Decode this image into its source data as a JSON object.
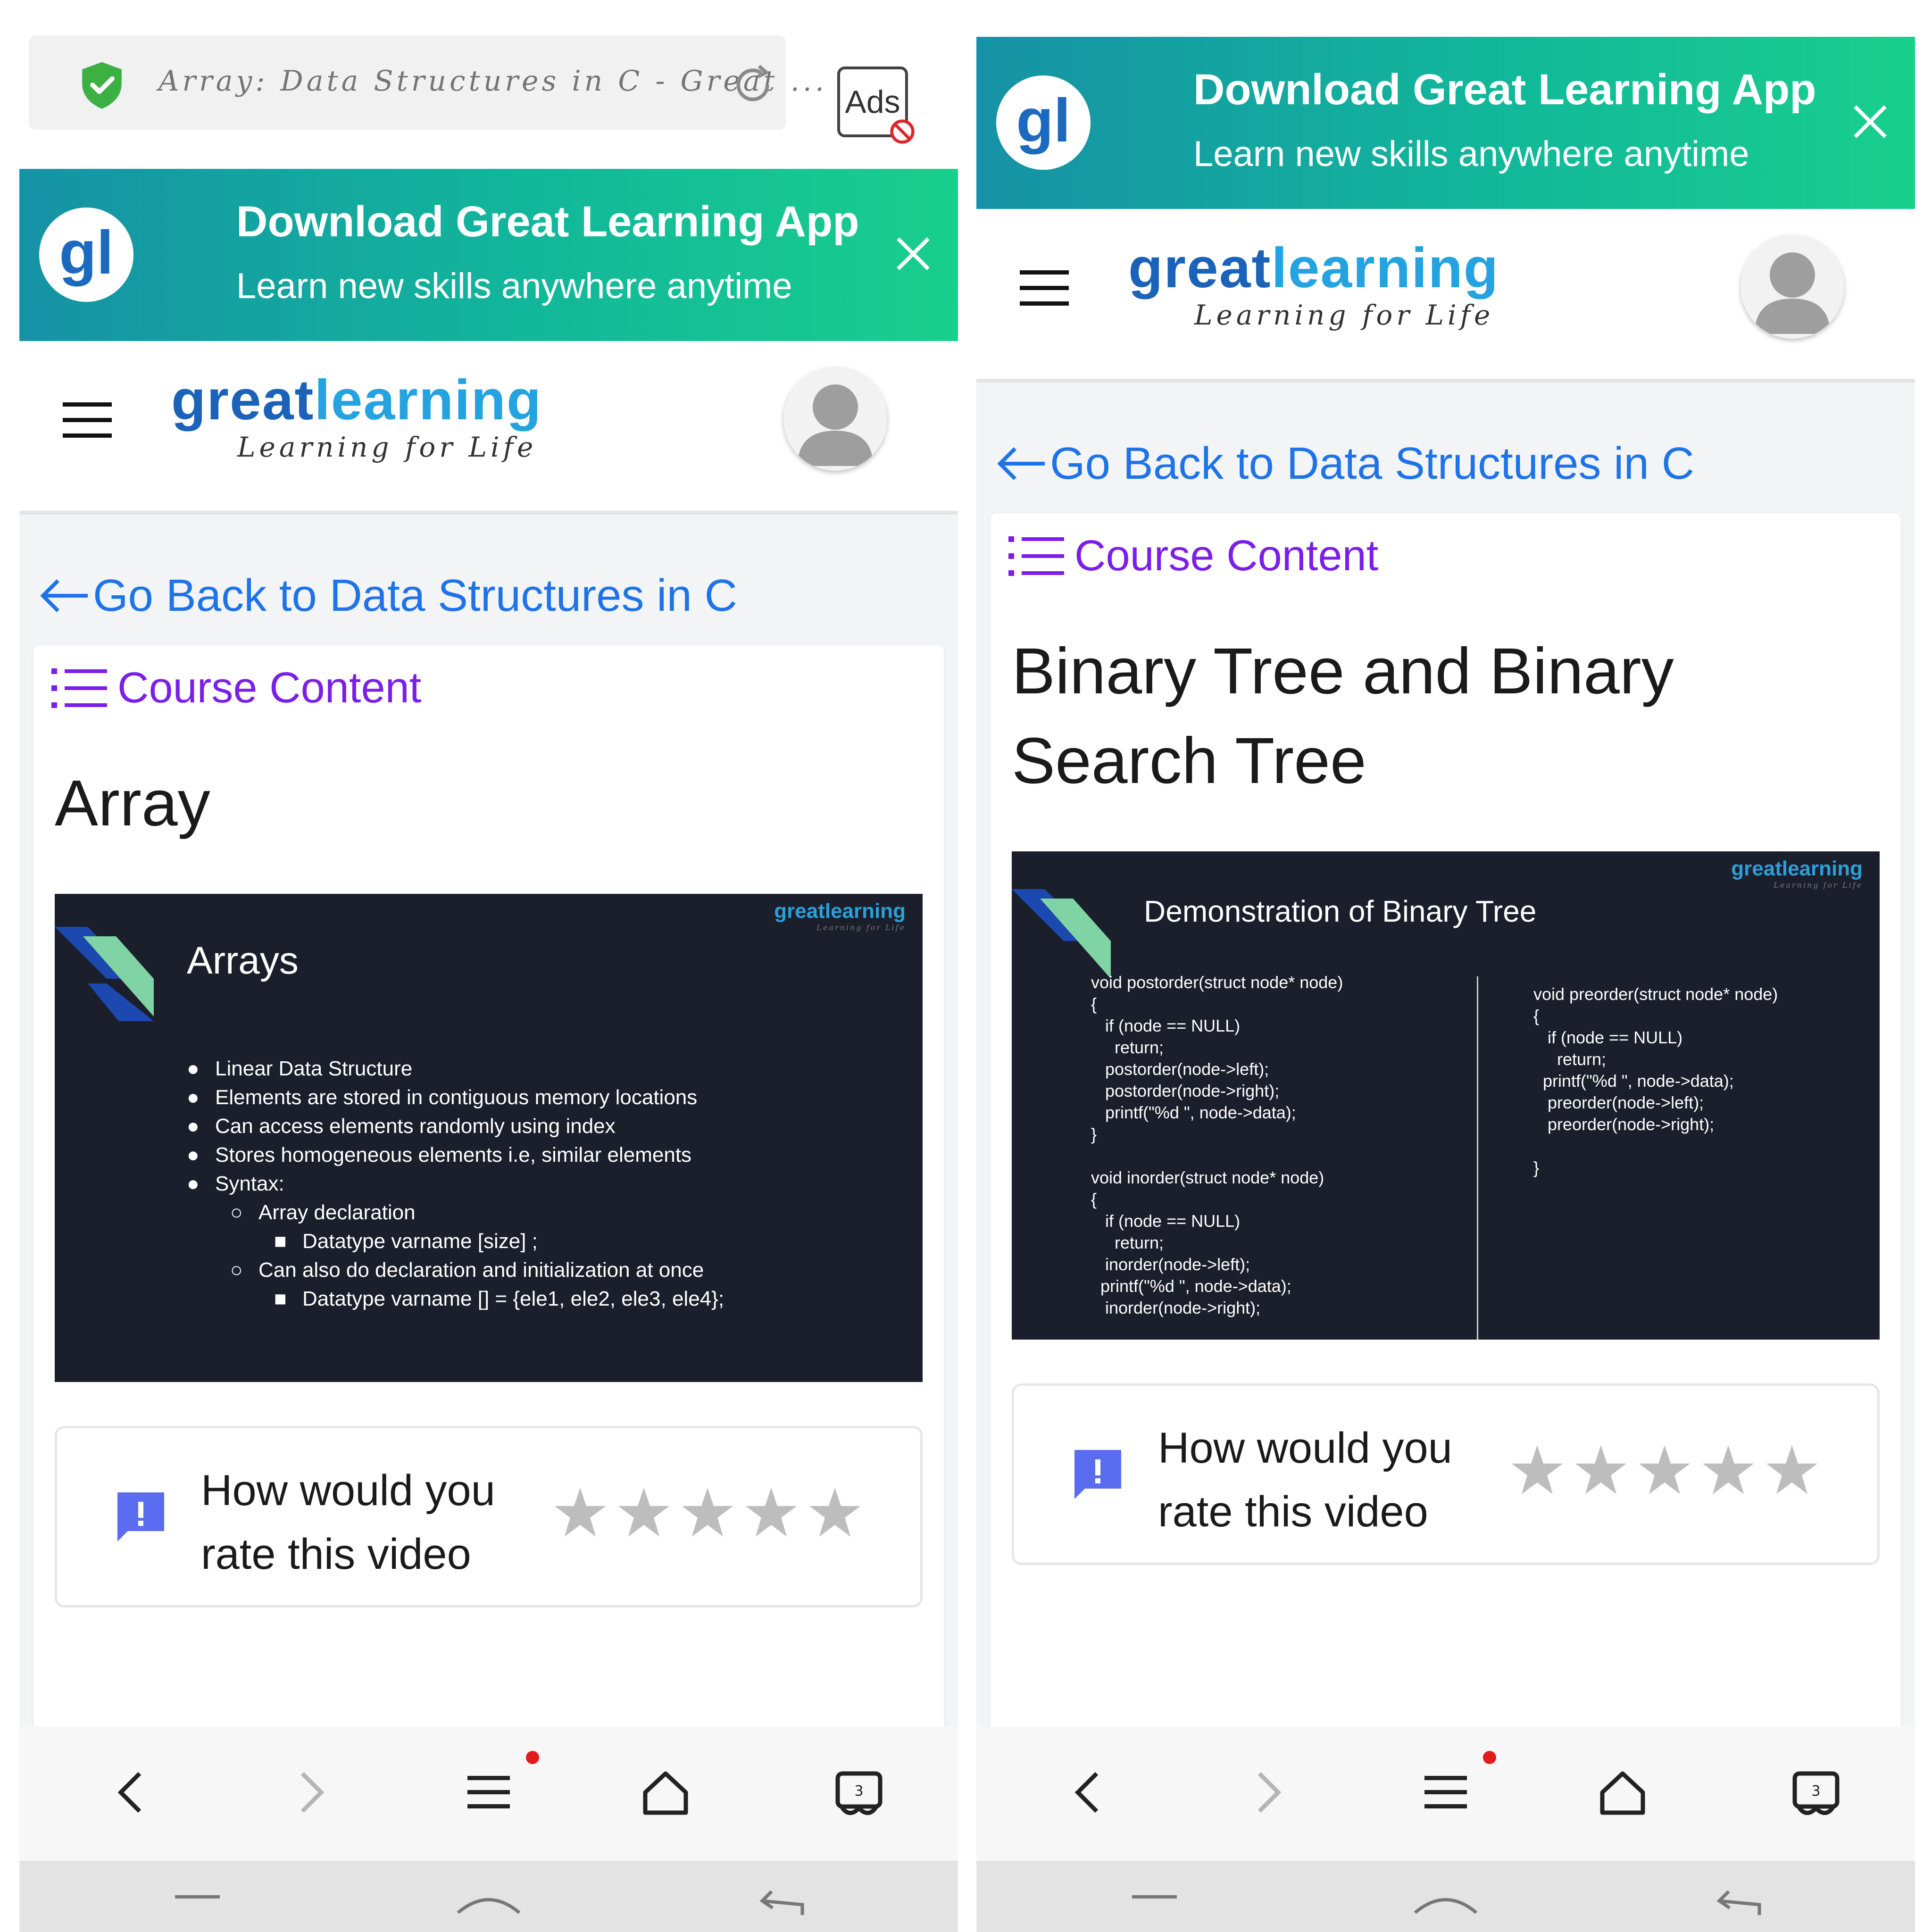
{
  "browser": {
    "url_title": "Array: Data Structures in C - Great ...",
    "ads_label": "Ads"
  },
  "app_banner": {
    "title": "Download Great Learning App",
    "subtitle": "Learn new skills anywhere anytime",
    "logo_text": "gl"
  },
  "header": {
    "brand_part1": "great",
    "brand_part2": "learning",
    "tagline": "Learning for Life"
  },
  "back_link": "Go Back to Data Structures in C",
  "course_content_label": "Course Content",
  "left": {
    "lesson_title": "Array",
    "slide": {
      "logo": "greatlearning",
      "logo_tag": "Learning for Life",
      "title": "Arrays",
      "bullets": [
        "Linear Data Structure",
        "Elements are stored in contiguous memory locations",
        "Can access elements randomly using index",
        "Stores homogeneous elements i.e, similar elements",
        "Syntax:",
        "Array declaration",
        "Datatype varname [size] ;",
        "Can also do declaration and initialization at once",
        "Datatype varname [] = {ele1, ele2, ele3, ele4};"
      ]
    }
  },
  "right": {
    "lesson_title": "Binary Tree and Binary Search Tree",
    "slide": {
      "logo": "greatlearning",
      "logo_tag": "Learning for Life",
      "title": "Demonstration of Binary Tree",
      "code_left": "void postorder(struct node* node)\n{\n   if (node == NULL)\n     return;\n   postorder(node->left);\n   postorder(node->right);\n   printf(\"%d \", node->data);\n}\n\nvoid inorder(struct node* node)\n{\n   if (node == NULL)\n     return;\n   inorder(node->left);\n  printf(\"%d \", node->data);\n   inorder(node->right);",
      "code_right": "void preorder(struct node* node)\n{\n   if (node == NULL)\n     return;\n  printf(\"%d \", node->data);\n   preorder(node->left);\n   preorder(node->right);\n\n}"
    }
  },
  "rating": {
    "question_line1": "How would you",
    "question_line2": "rate this video",
    "stars": 5
  },
  "colors": {
    "banner_start": "#1692a6",
    "banner_end": "#18cf8c",
    "link_blue": "#1e73e8",
    "course_purple": "#7b1fe8",
    "slide_bg": "#1b1f2b",
    "star_gray": "#bdbdbd",
    "feedback_icon": "#5a6cf0"
  },
  "icons": [
    "shield-check-icon",
    "reload-icon",
    "ads-block-icon",
    "gl-logo-icon",
    "close-icon",
    "hamburger-menu-icon",
    "avatar-icon",
    "arrow-left-icon",
    "list-icon",
    "feedback-icon",
    "star-icon",
    "back-icon",
    "forward-icon",
    "menu-icon",
    "home-icon",
    "tabs-icon"
  ]
}
